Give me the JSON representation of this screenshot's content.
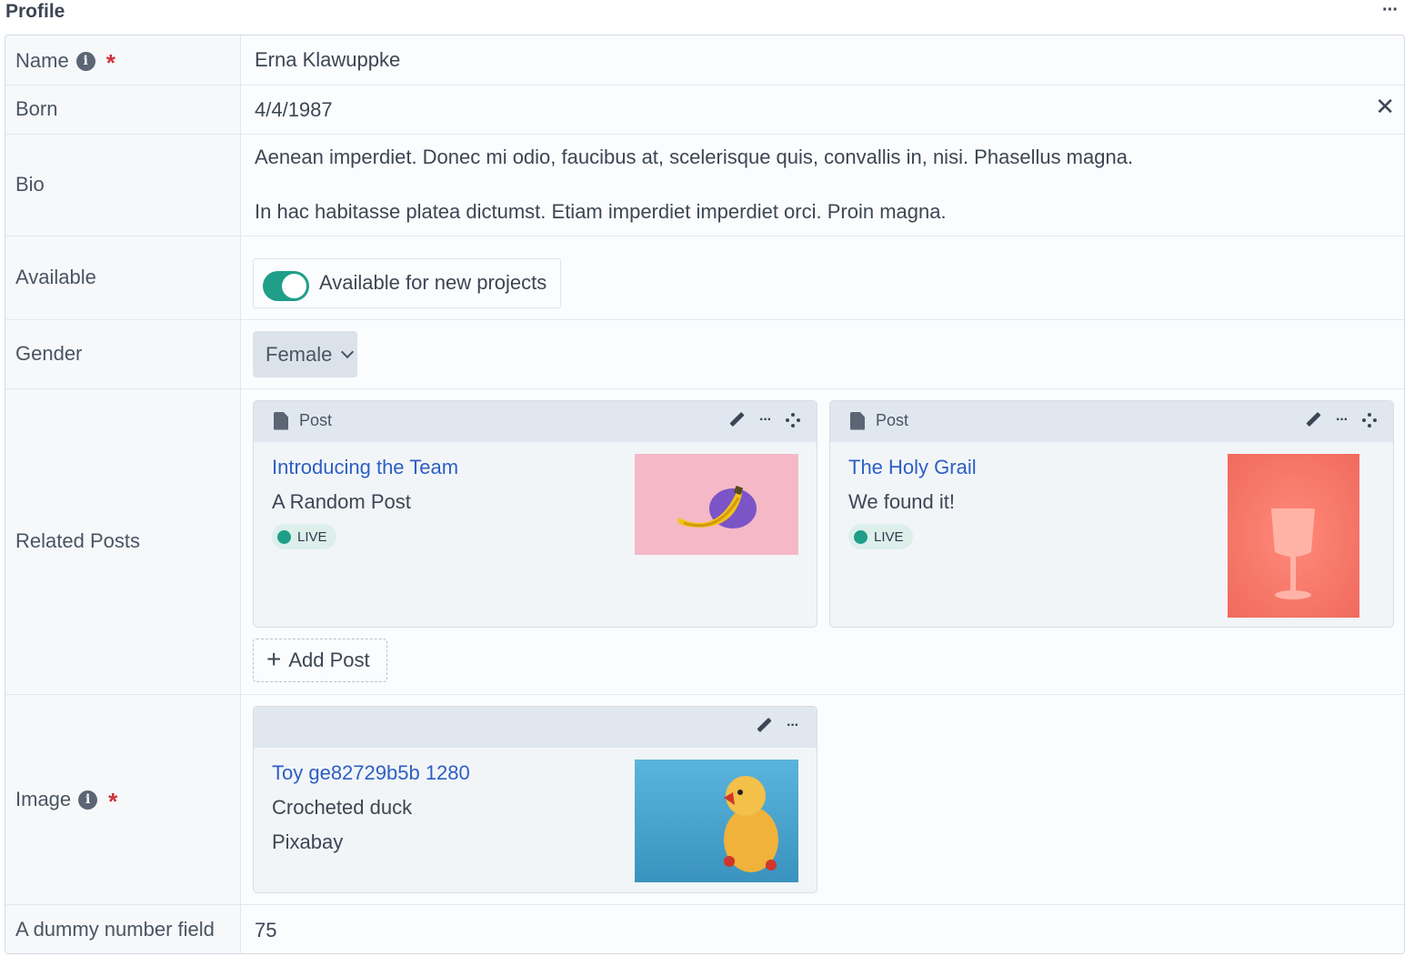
{
  "panel": {
    "title": "Profile",
    "menu": "···"
  },
  "fields": {
    "name": {
      "label": "Name",
      "value": "Erna Klawuppke"
    },
    "born": {
      "label": "Born",
      "value": "4/4/1987",
      "clear": "✕"
    },
    "bio": {
      "label": "Bio",
      "paragraphs": [
        "Aenean imperdiet. Donec mi odio, faucibus at, scelerisque quis, convallis in, nisi. Phasellus magna.",
        "In hac habitasse platea dictumst. Etiam imperdiet imperdiet orci. Proin magna."
      ]
    },
    "available": {
      "label": "Available",
      "toggle_label": "Available for new projects",
      "checked": true
    },
    "gender": {
      "label": "Gender",
      "value": "Female"
    },
    "related_posts": {
      "label": "Related Posts",
      "posts": [
        {
          "type": "Post",
          "title": "Introducing the Team",
          "subtitle": "A Random Post",
          "status": "LIVE",
          "image": "banana on pink background"
        },
        {
          "type": "Post",
          "title": "The Holy Grail",
          "subtitle": "We found it!",
          "status": "LIVE",
          "image": "pink goblet on red background"
        }
      ],
      "add_label": "Add Post"
    },
    "image": {
      "label": "Image",
      "title": "Toy ge82729b5b 1280",
      "caption": "Crocheted duck",
      "credit": "Pixabay",
      "image": "crocheted yellow duck on blue"
    },
    "number": {
      "label": "A dummy number field",
      "value": "75"
    }
  },
  "icons": {
    "info": "info-icon",
    "required": "*",
    "menu": "···",
    "edit": "pencil-icon",
    "drag": "drag-icon",
    "document": "document-icon"
  },
  "colors": {
    "accent": "#1f9e88",
    "link": "#2d5fc4",
    "required": "#d1303a"
  }
}
